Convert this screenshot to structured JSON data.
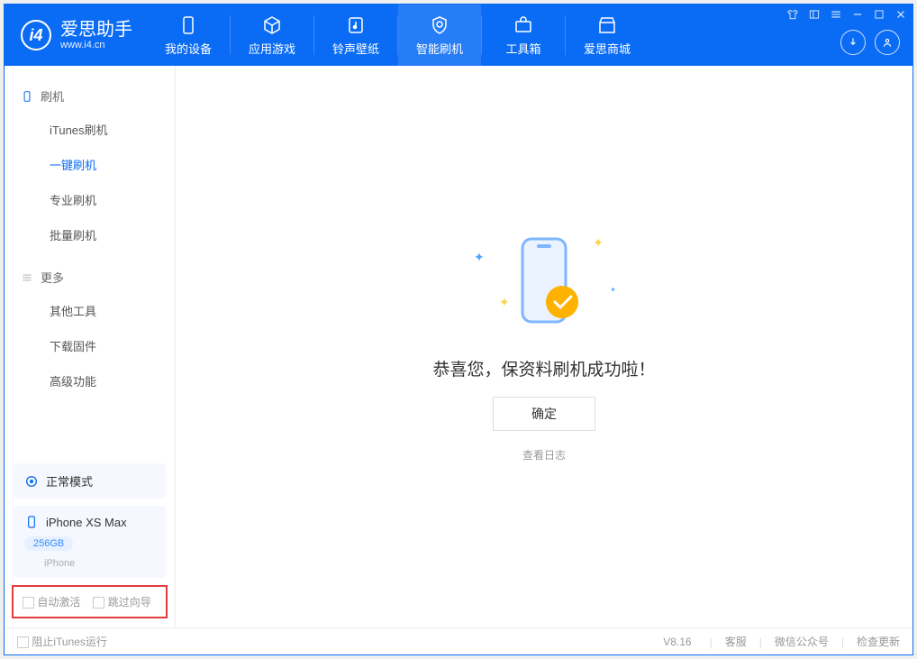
{
  "app": {
    "name": "爱思助手",
    "sub": "www.i4.cn"
  },
  "tabs": [
    "我的设备",
    "应用游戏",
    "铃声壁纸",
    "智能刷机",
    "工具箱",
    "爱思商城"
  ],
  "activeTab": 3,
  "sidebar": {
    "group1": {
      "title": "刷机",
      "items": [
        "iTunes刷机",
        "一键刷机",
        "专业刷机",
        "批量刷机"
      ],
      "active": 1
    },
    "group2": {
      "title": "更多",
      "items": [
        "其他工具",
        "下载固件",
        "高级功能"
      ]
    }
  },
  "device": {
    "mode": "正常模式",
    "model": "iPhone XS Max",
    "capacity": "256GB",
    "type": "iPhone"
  },
  "options": {
    "autoActivate": "自动激活",
    "skipGuide": "跳过向导"
  },
  "main": {
    "success": "恭喜您，保资料刷机成功啦！",
    "ok": "确定",
    "viewLog": "查看日志"
  },
  "footer": {
    "stopItunes": "阻止iTunes运行",
    "version": "V8.16",
    "links": [
      "客服",
      "微信公众号",
      "检查更新"
    ]
  }
}
